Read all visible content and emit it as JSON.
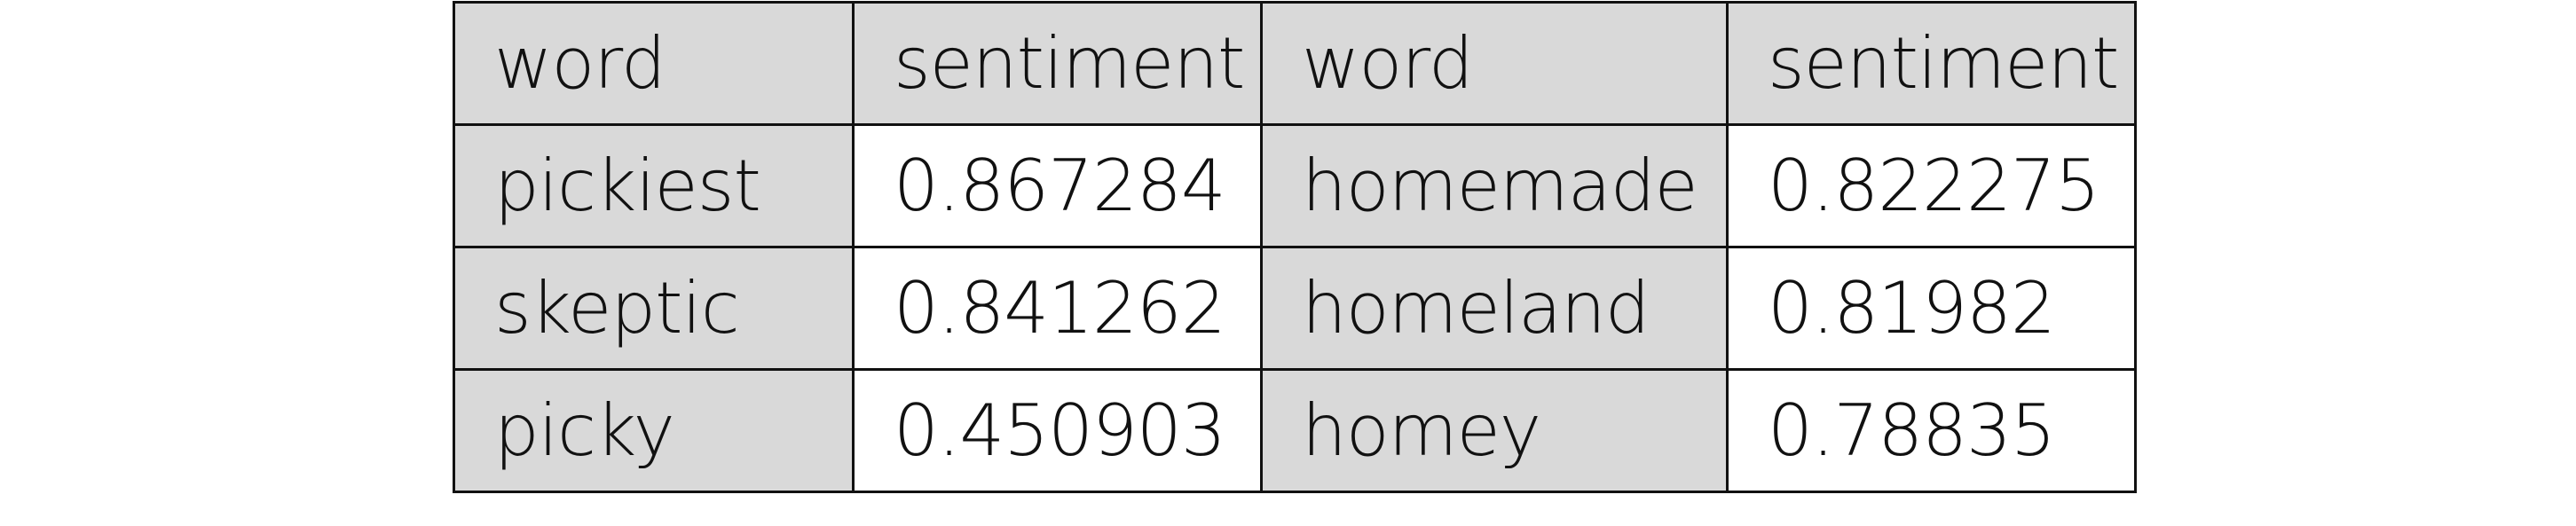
{
  "table": {
    "headers": [
      "word",
      "sentiment",
      "word",
      "sentiment"
    ],
    "rows": [
      [
        "pickiest",
        "0.867284",
        "homemade",
        "0.822275"
      ],
      [
        "skeptic",
        "0.841262",
        "homeland",
        "0.81982"
      ],
      [
        "picky",
        "0.450903",
        "homey",
        "0.78835"
      ]
    ]
  },
  "colors": {
    "shaded_cell": "#d9d9d9",
    "plain_cell": "#ffffff",
    "border": "#111111",
    "text": "#111111"
  }
}
